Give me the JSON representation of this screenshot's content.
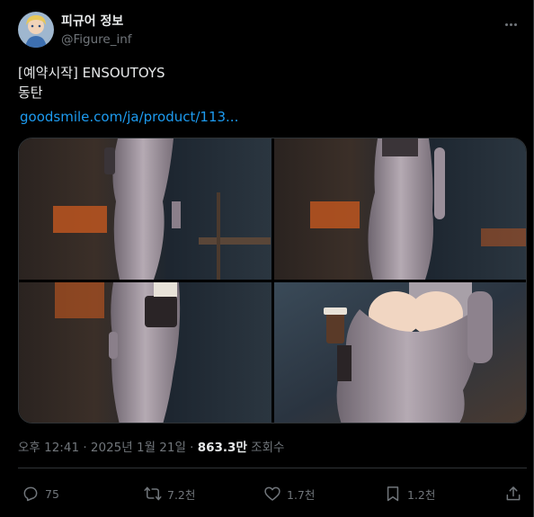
{
  "author": {
    "display_name": "피규어 정보",
    "handle": "@Figure_inf"
  },
  "tweet": {
    "line1": "[예약시작] ENSOUTOYS",
    "line2": "동탄",
    "link_text": "goodsmile.com/ja/product/113..."
  },
  "meta": {
    "time": "오후 12:41 · 2025년 1월 21일 · ",
    "views": "863.3만",
    "views_label": " 조회수"
  },
  "actions": {
    "reply_count": "75",
    "retweet_count": "7.2천",
    "like_count": "1.7천",
    "bookmark_count": "1.2천"
  },
  "colors": {
    "background": "#000000",
    "text": "#e7e9ea",
    "secondary": "#71767b",
    "link": "#1d9bf0",
    "border": "#2f3336"
  },
  "icons": [
    "more-icon",
    "reply-icon",
    "retweet-icon",
    "like-icon",
    "bookmark-icon",
    "share-icon"
  ]
}
